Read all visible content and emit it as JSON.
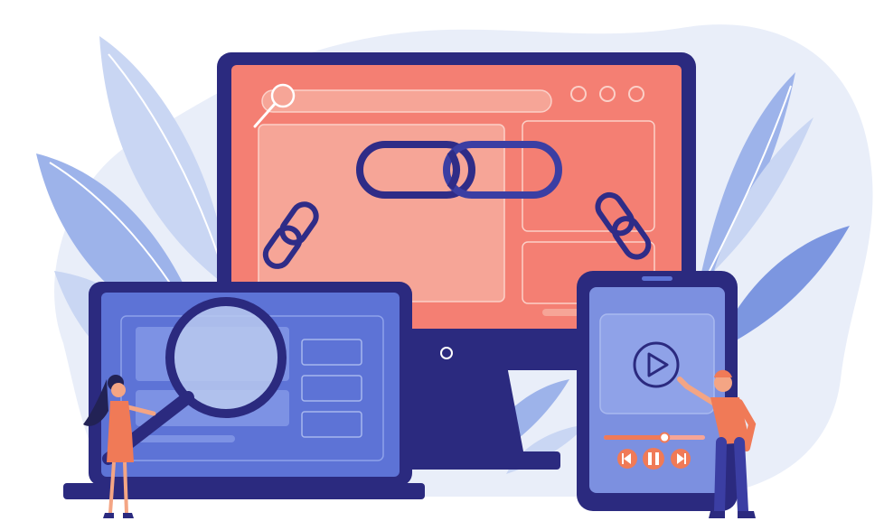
{
  "scene": {
    "subject": "illustration-devices-links",
    "colors": {
      "background": "#ffffff",
      "blob": "#e9eef9",
      "leaf_light": "#c9d6f3",
      "leaf_mid": "#9db3ea",
      "leaf_dark": "#7c96e0",
      "device_frame": "#2b2a7f",
      "monitor_screen": "#f47f73",
      "monitor_screen_light": "#f6a597",
      "laptop_screen": "#5d73d6",
      "laptop_screen_light": "#7d92e4",
      "tablet_screen": "#7c90e0",
      "chain": "#2f2c87",
      "magnifier_lens": "#b9c9ef",
      "person_orange": "#f07a57",
      "skin": "#f4a584",
      "hair_dark": "#222255"
    },
    "icons": [
      "search-icon",
      "window-dot-icon",
      "link-chain-icon",
      "magnifying-glass-icon",
      "play-icon",
      "previous-icon",
      "pause-icon",
      "next-icon"
    ],
    "player": {
      "progress": 0.6
    }
  }
}
